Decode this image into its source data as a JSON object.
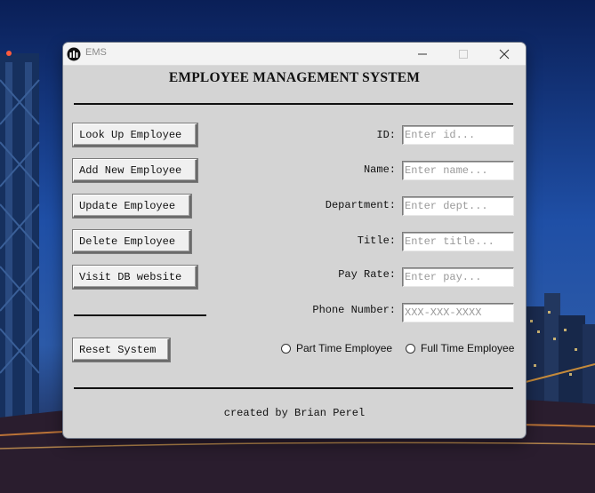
{
  "window": {
    "title": "EMS"
  },
  "heading": "EMPLOYEE MANAGEMENT SYSTEM",
  "buttons": {
    "lookup": "Look Up Employee",
    "add": "Add New Employee",
    "update": "Update Employee",
    "delete": "Delete Employee",
    "visit": "Visit DB website",
    "reset": "Reset System"
  },
  "form": {
    "id": {
      "label": "ID:",
      "placeholder": "Enter id..."
    },
    "name": {
      "label": "Name:",
      "placeholder": "Enter name..."
    },
    "department": {
      "label": "Department:",
      "placeholder": "Enter dept..."
    },
    "title": {
      "label": "Title:",
      "placeholder": "Enter title..."
    },
    "pay": {
      "label": "Pay Rate:",
      "placeholder": "Enter pay..."
    },
    "phone": {
      "label": "Phone Number:",
      "placeholder": "XXX-XXX-XXXX"
    }
  },
  "employment_type": {
    "part_time": "Part Time Employee",
    "full_time": "Full Time Employee"
  },
  "footer": {
    "credit": "created by Brian Perel"
  }
}
